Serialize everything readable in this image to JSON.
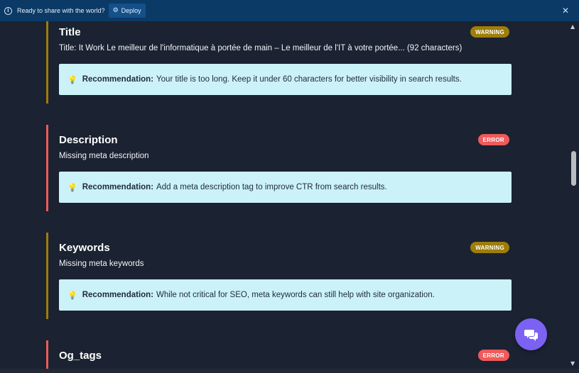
{
  "topbar": {
    "message": "Ready to share with the world?",
    "deploy_label": "Deploy"
  },
  "colors": {
    "warning": "#9e7d0a",
    "error": "#ef5a5a",
    "recommendation_bg": "#cbf2f8",
    "chat_button": "#7b62f2"
  },
  "recommendation_label": "Recommendation:",
  "cards": [
    {
      "title": "Title",
      "severity": "WARNING",
      "detail": "Title: It Work Le meilleur de l'informatique à portée de main – Le meilleur de l'IT à votre portée... (92 characters)",
      "recommendation": "Your title is too long. Keep it under 60 characters for better visibility in search results."
    },
    {
      "title": "Description",
      "severity": "ERROR",
      "detail": "Missing meta description",
      "recommendation": "Add a meta description tag to improve CTR from search results."
    },
    {
      "title": "Keywords",
      "severity": "WARNING",
      "detail": "Missing meta keywords",
      "recommendation": "While not critical for SEO, meta keywords can still help with site organization."
    },
    {
      "title": "Og_tags",
      "severity": "ERROR"
    }
  ],
  "icons": {
    "info": "info-icon",
    "deploy": "deploy-icon",
    "close": "close-icon",
    "bulb": "lightbulb-icon",
    "chat": "chat-bubbles-icon"
  }
}
